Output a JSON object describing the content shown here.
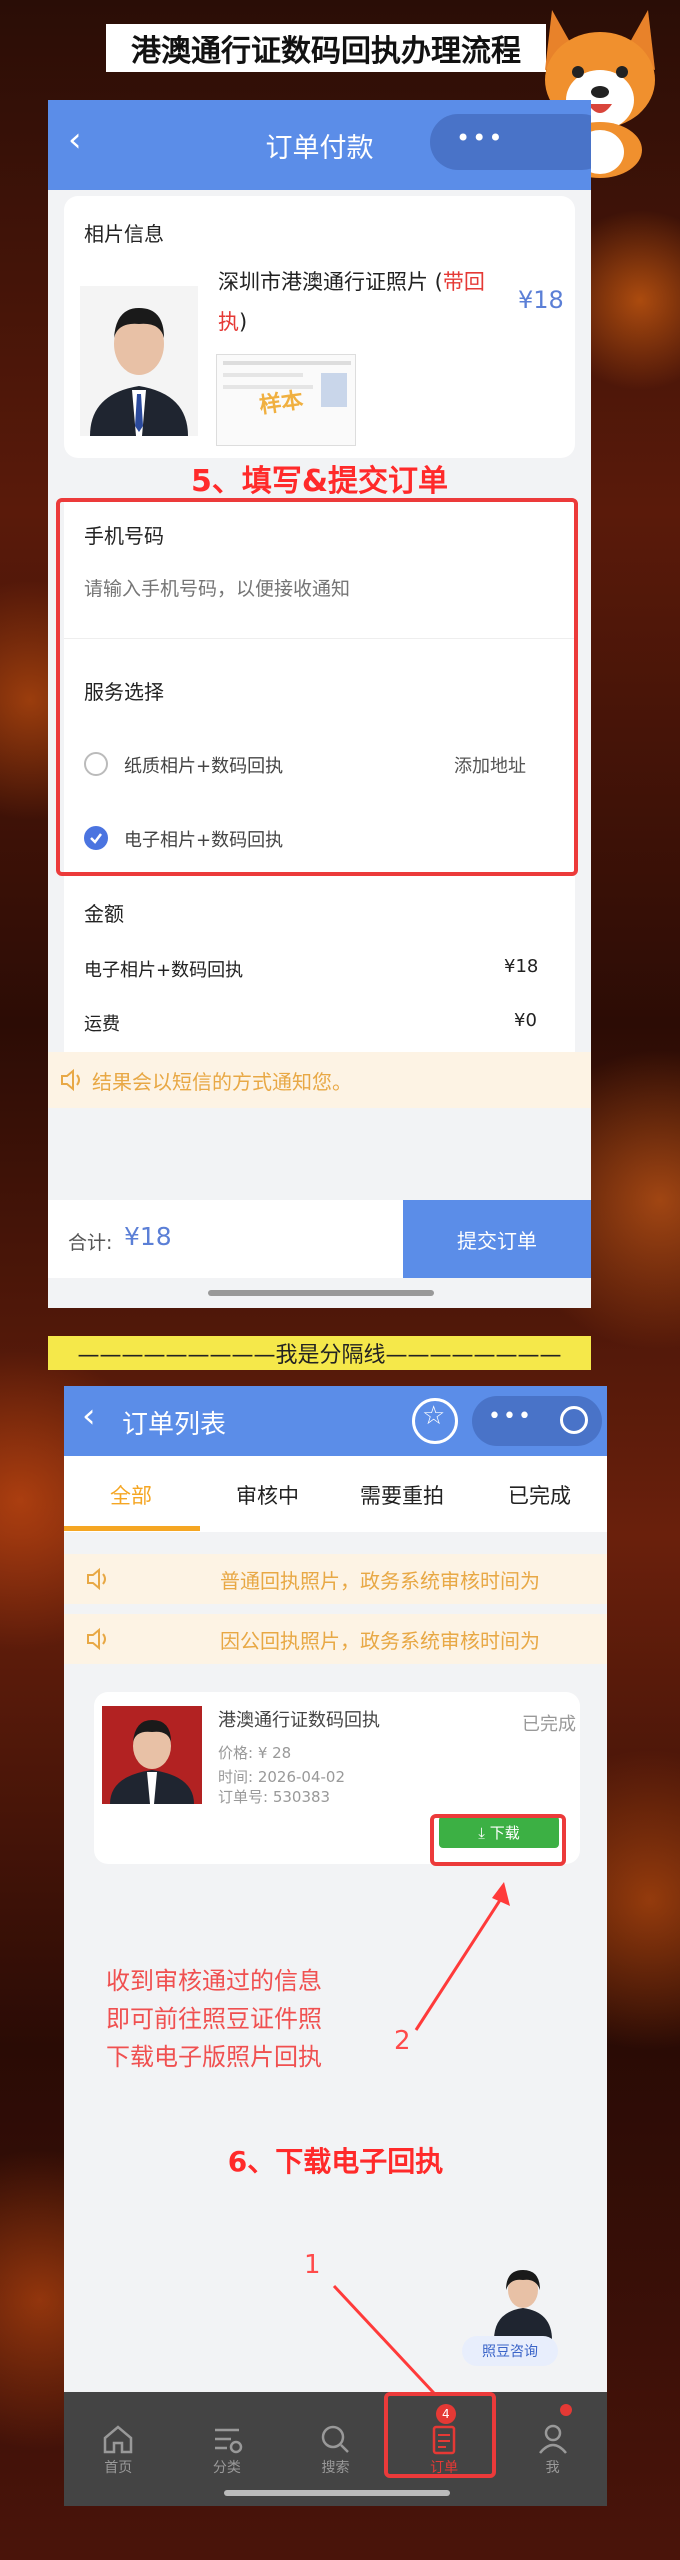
{
  "banner_title": "港澳通行证数码回执办理流程",
  "order_page": {
    "nav_title": "订单付款",
    "photo_section_label": "相片信息",
    "product_name": "深圳市港澳通行证照片 (",
    "product_name_highlight": "带回执",
    "product_name_close": ")",
    "sample_watermark": "样本",
    "product_price": "¥18",
    "step5_annotation": "5、填写&提交订单",
    "phone_label": "手机号码",
    "phone_placeholder": "请输入手机号码，以便接收通知",
    "service_label": "服务选择",
    "service_options": [
      {
        "label": "纸质相片+数码回执",
        "extra": "添加地址",
        "selected": false
      },
      {
        "label": "电子相片+数码回执",
        "extra": "",
        "selected": true
      }
    ],
    "amount_label": "金额",
    "amount_rows": [
      {
        "name": "电子相片+数码回执",
        "value": "¥18"
      },
      {
        "name": "运费",
        "value": "¥0"
      }
    ],
    "notice_text": "结果会以短信的方式通知您。",
    "total_label": "合计:",
    "total_value": "¥18",
    "submit_button": "提交订单"
  },
  "divider_text": "—————————我是分隔线————————",
  "orders_page": {
    "nav_title": "订单列表",
    "tabs": [
      "全部",
      "审核中",
      "需要重拍",
      "已完成"
    ],
    "active_tab": 0,
    "notices": [
      "普通回执照片，政务系统审核时间为",
      "因公回执照片，政务系统审核时间为"
    ],
    "order": {
      "title": "港澳通行证数码回执",
      "status": "已完成",
      "price": "价格: ¥ 28",
      "time": "时间: 2026-04-02",
      "order_no": "订单号: 530383",
      "download_button": "⤓ 下载"
    },
    "instruction_lines": [
      "收到审核通过的信息",
      "即可前往照豆证件照",
      "下载电子版照片回执"
    ],
    "arrow_label_2": "2",
    "step6_annotation": "6、下载电子回执",
    "arrow_label_1": "1",
    "consult_label": "照豆咨询",
    "tabbar": [
      {
        "label": "首页",
        "icon": "home-icon"
      },
      {
        "label": "分类",
        "icon": "category-icon"
      },
      {
        "label": "搜索",
        "icon": "search-icon"
      },
      {
        "label": "订单",
        "icon": "order-icon",
        "badge": "4"
      },
      {
        "label": "我",
        "icon": "user-icon"
      }
    ]
  },
  "colors": {
    "nav_blue": "#5b8de8",
    "annotation_red": "#ff2a2a",
    "download_green": "#3cb044",
    "divider_yellow": "#f5e84a"
  }
}
